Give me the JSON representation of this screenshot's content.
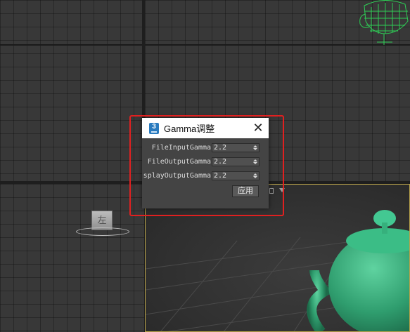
{
  "dialog": {
    "icon_label": "3",
    "title": "Gamma调整",
    "close_symbol": "✕",
    "fields": [
      {
        "label": "FileInputGamma",
        "value": "2.2"
      },
      {
        "label": "FileOutputGamma",
        "value": "2.2"
      },
      {
        "label": "splayOutputGamma",
        "value": "2.2"
      }
    ],
    "apply_label": "应用"
  },
  "viewcube": {
    "face_label": "左"
  },
  "colors": {
    "highlight": "#e02020",
    "teapot": "#3aa87a",
    "viewport_border": "#b8a24a"
  },
  "icons": [
    "app-icon",
    "close-icon",
    "spinner-arrows-icon",
    "viewport-menu-arrow-icon"
  ]
}
